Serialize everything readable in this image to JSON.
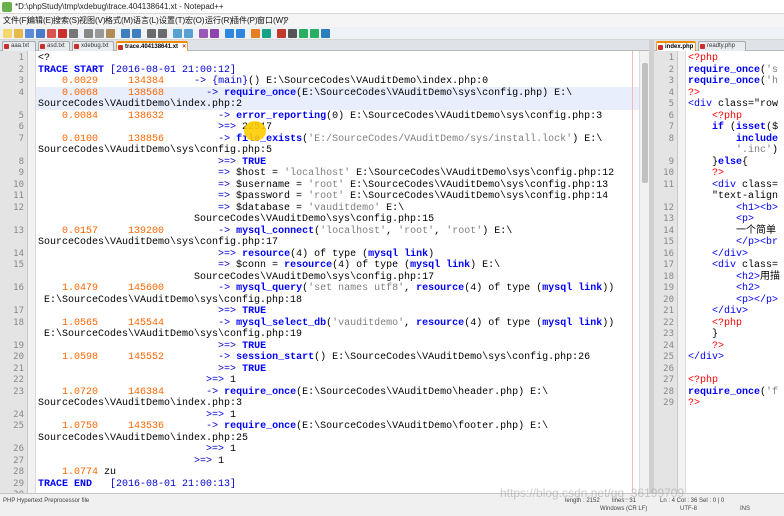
{
  "window": {
    "title": "*D:\\phpStudy\\tmp\\xdebug\\trace.404138641.xt - Notepad++"
  },
  "menu": [
    "文件(F)",
    "编辑(E)",
    "搜索(S)",
    "视图(V)",
    "格式(M)",
    "语言(L)",
    "设置(T)",
    "宏(O)",
    "运行(R)",
    "插件(P)",
    "窗口(W)",
    "?"
  ],
  "tabs_left": [
    {
      "label": "aaa.txt",
      "active": false
    },
    {
      "label": "asd.txt",
      "active": false
    },
    {
      "label": "xdebug.txt",
      "active": false
    },
    {
      "label": "trace.404138641.xt",
      "active": true
    }
  ],
  "tabs_right": [
    {
      "label": "index.php",
      "active": true
    },
    {
      "label": "readty.php",
      "active": false
    }
  ],
  "left_lines": [
    [
      "1",
      "<?"
    ],
    [
      "2",
      "TRACE START [2016-08-01 21:00:12]"
    ],
    [
      "3",
      "    0.0029     134384     -> {main}() E:\\SourceCodes\\VAuditDemo\\index.php:0"
    ],
    [
      "4",
      "    0.0068     138568       -> require_once(E:\\SourceCodes\\VAuditDemo\\sys\\config.php) E:\\"
    ],
    [
      "",
      "SourceCodes\\VAuditDemo\\index.php:2"
    ],
    [
      "5",
      "    0.0084     138632         -> error_reporting(0) E:\\SourceCodes\\VAuditDemo\\sys\\config.php:3"
    ],
    [
      "6",
      "                              >=> 22517"
    ],
    [
      "7",
      "    0.0100     138856         -> file_exists('E:/SourceCodes/VAuditDemo/sys/install.lock') E:\\"
    ],
    [
      "",
      "SourceCodes\\VAuditDemo\\sys\\config.php:5"
    ],
    [
      "8",
      "                              >=> TRUE"
    ],
    [
      "9",
      "                              => $host = 'localhost' E:\\SourceCodes\\VAuditDemo\\sys\\config.php:12"
    ],
    [
      "10",
      "                              => $username = 'root' E:\\SourceCodes\\VAuditDemo\\sys\\config.php:13"
    ],
    [
      "11",
      "                              => $password = 'root' E:\\SourceCodes\\VAuditDemo\\sys\\config.php:14"
    ],
    [
      "12",
      "                              => $database = 'vauditdemo' E:\\"
    ],
    [
      "",
      "                          SourceCodes\\VAuditDemo\\sys\\config.php:15"
    ],
    [
      "13",
      "    0.0157     139200         -> mysql_connect('localhost', 'root', 'root') E:\\"
    ],
    [
      "",
      "SourceCodes\\VAuditDemo\\sys\\config.php:17"
    ],
    [
      "14",
      "                              >=> resource(4) of type (mysql link)"
    ],
    [
      "15",
      "                              => $conn = resource(4) of type (mysql link) E:\\"
    ],
    [
      "",
      "                          SourceCodes\\VAuditDemo\\sys\\config.php:17"
    ],
    [
      "16",
      "    1.0479     145600         -> mysql_query('set names utf8', resource(4) of type (mysql link))"
    ],
    [
      "",
      " E:\\SourceCodes\\VAuditDemo\\sys\\config.php:18"
    ],
    [
      "17",
      "                              >=> TRUE"
    ],
    [
      "18",
      "    1.0565     145544         -> mysql_select_db('vauditdemo', resource(4) of type (mysql link))"
    ],
    [
      "",
      " E:\\SourceCodes\\VAuditDemo\\sys\\config.php:19"
    ],
    [
      "19",
      "                              >=> TRUE"
    ],
    [
      "20",
      "    1.0598     145552         -> session_start() E:\\SourceCodes\\VAuditDemo\\sys\\config.php:26"
    ],
    [
      "21",
      "                              >=> TRUE"
    ],
    [
      "22",
      "                            >=> 1"
    ],
    [
      "23",
      "    1.0720     146384       -> require_once(E:\\SourceCodes\\VAuditDemo\\header.php) E:\\"
    ],
    [
      "",
      "SourceCodes\\VAuditDemo\\index.php:3"
    ],
    [
      "24",
      "                            >=> 1"
    ],
    [
      "25",
      "    1.0750     143536       -> require_once(E:\\SourceCodes\\VAuditDemo\\footer.php) E:\\"
    ],
    [
      "",
      "SourceCodes\\VAuditDemo\\index.php:25"
    ],
    [
      "26",
      "                            >=> 1"
    ],
    [
      "27",
      "                          >=> 1"
    ],
    [
      "28",
      "    1.0774 zu"
    ],
    [
      "29",
      "TRACE END   [2016-08-01 21:00:13]"
    ],
    [
      "30",
      ""
    ]
  ],
  "right_lines": [
    [
      "1",
      "<?php"
    ],
    [
      "2",
      "require_once('s"
    ],
    [
      "3",
      "require_once('h"
    ],
    [
      "4",
      "?>"
    ],
    [
      "5",
      "<div class=\"row"
    ],
    [
      "6",
      "    <?php"
    ],
    [
      "7",
      "    if (isset($"
    ],
    [
      "8",
      "        include"
    ],
    [
      "",
      "        '.inc')"
    ],
    [
      "9",
      "    }else{"
    ],
    [
      "10",
      "    ?>"
    ],
    [
      "11",
      "    <div class="
    ],
    [
      "",
      "    \"text-align"
    ],
    [
      "12",
      "        <h1><b>"
    ],
    [
      "13",
      "        <p>"
    ],
    [
      "14",
      "        一个简单"
    ],
    [
      "15",
      "        </p><br"
    ],
    [
      "16",
      "    </div>"
    ],
    [
      "17",
      "    <div class="
    ],
    [
      "18",
      "        <h2>用描"
    ],
    [
      "19",
      "        <h2>"
    ],
    [
      "20",
      "        <p></p>"
    ],
    [
      "21",
      "    </div>"
    ],
    [
      "22",
      "    <?php"
    ],
    [
      "23",
      "    }"
    ],
    [
      "24",
      "    ?>"
    ],
    [
      "25",
      "</div>"
    ],
    [
      "26",
      ""
    ],
    [
      "27",
      "<?php"
    ],
    [
      "28",
      "require_once('f"
    ],
    [
      "29",
      "?>"
    ]
  ],
  "status": {
    "filetype": "PHP Hypertext Preprocessor file",
    "length": "length : 2152",
    "lines": "lines : 31",
    "position": "Ln : 4    Col : 36    Sel : 0 | 0",
    "eol": "Windows (CR LF)",
    "encoding": "UTF-8",
    "mode": "INS"
  },
  "watermark": "https://blog.csdn.net/qq_36199709",
  "colors": {
    "accent_tab": "#f08c00",
    "keyword": "#0000ff",
    "number": "#ff6600",
    "string": "#7f7f7f",
    "html_tag": "#0000ee",
    "php_tag": "#ff0000"
  }
}
